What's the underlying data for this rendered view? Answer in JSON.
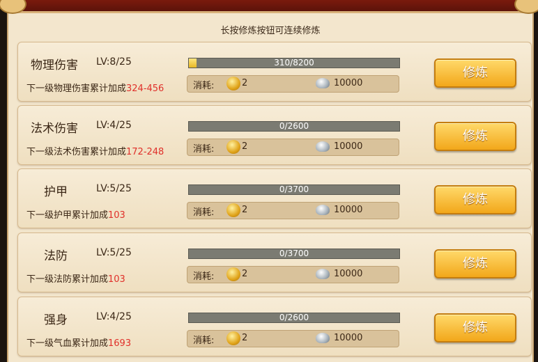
{
  "hint": "长按修炼按钮可连续修炼",
  "cost_label": "消耗:",
  "button_label": "修炼",
  "rows": [
    {
      "name": "物理伤害",
      "level": "LV:8/25",
      "progress_text": "310/8200",
      "progress": 0.038,
      "desc_prefix": "下一级物理伤害累计加成",
      "desc_value": "324-456",
      "gold_cost": "2",
      "silver_cost": "10000"
    },
    {
      "name": "法术伤害",
      "level": "LV:4/25",
      "progress_text": "0/2600",
      "progress": 0,
      "desc_prefix": "下一级法术伤害累计加成",
      "desc_value": "172-248",
      "gold_cost": "2",
      "silver_cost": "10000"
    },
    {
      "name": "护甲",
      "level": "LV:5/25",
      "progress_text": "0/3700",
      "progress": 0,
      "desc_prefix": "下一级护甲累计加成",
      "desc_value": "103",
      "gold_cost": "2",
      "silver_cost": "10000"
    },
    {
      "name": "法防",
      "level": "LV:5/25",
      "progress_text": "0/3700",
      "progress": 0,
      "desc_prefix": "下一级法防累计加成",
      "desc_value": "103",
      "gold_cost": "2",
      "silver_cost": "10000"
    },
    {
      "name": "强身",
      "level": "LV:4/25",
      "progress_text": "0/2600",
      "progress": 0,
      "desc_prefix": "下一级气血累计加成",
      "desc_value": "1693",
      "gold_cost": "2",
      "silver_cost": "10000"
    }
  ],
  "colors": {
    "value_red": "#e0302a",
    "button_gold": "#f2a71a",
    "bar_fill": "#e8b824"
  }
}
